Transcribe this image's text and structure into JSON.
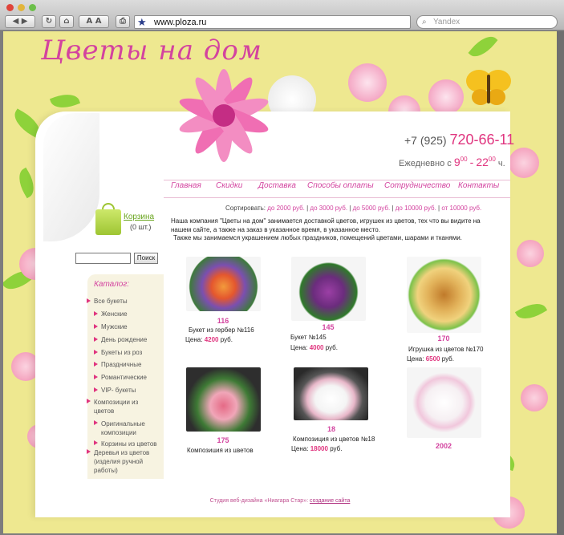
{
  "browser": {
    "url": "www.ploza.ru",
    "search_placeholder": "Yandex",
    "font_button": "A A"
  },
  "site": {
    "logo": "Цветы на дом",
    "phone_prefix": "+7 (925)",
    "phone_main": "720-66-11",
    "hours_prefix": "Ежедневно с",
    "hours_from": "9",
    "hours_from_min": "00",
    "hours_to": "22",
    "hours_to_min": "00",
    "hours_suffix": "ч."
  },
  "nav": [
    "Главная",
    "Скидки",
    "Доставка",
    "Способы оплаты",
    "Сотрудничество",
    "Контакты"
  ],
  "cart": {
    "label": "Корзина",
    "count": "(0 шт.)"
  },
  "search": {
    "button": "Поиск"
  },
  "catalog": {
    "title": "Каталог:",
    "items": [
      {
        "label": "Все букеты"
      },
      {
        "label": "Женские"
      },
      {
        "label": "Мужские"
      },
      {
        "label": "День рождение"
      },
      {
        "label": "Букеты из роз"
      },
      {
        "label": "Праздничные"
      },
      {
        "label": "Романтические"
      },
      {
        "label": "VIP- букеты"
      },
      {
        "label": "Композиции из цветов"
      },
      {
        "label": "Оригинальные композиции"
      },
      {
        "label": "Корзины из цветов"
      },
      {
        "label": "Деревья из цветов (изделия ручной работы)"
      }
    ]
  },
  "sort": {
    "label": "Сортировать:",
    "options": [
      "до 2000 руб.",
      "до 3000 руб.",
      "до 5000 руб.",
      "до 10000 руб.",
      "от 10000 руб."
    ]
  },
  "intro": {
    "line1": "Наша компания \"Цветы на дом\" занимается доставкой цветов, игрушек из цветов, тех что вы видите на нашем сайте, а также на заказ в указанное время, в указанное место.",
    "line2": "Также мы занимаемся украшением любых праздников, помещений цветами, шарами и тканями."
  },
  "products": [
    {
      "num": "116",
      "name": "Букет из гербер №116",
      "price_label": "Цена:",
      "price": "4200",
      "currency": "руб."
    },
    {
      "num": "145",
      "name": "Букет №145",
      "price_label": "Цена:",
      "price": "4000",
      "currency": "руб."
    },
    {
      "num": "170",
      "name": "Игрушка из цветов №170",
      "price_label": "Цена:",
      "price": "6500",
      "currency": "руб."
    },
    {
      "num": "175",
      "name": "Композиция из цветов",
      "price_label": "",
      "price": "",
      "currency": ""
    },
    {
      "num": "18",
      "name": "Композиция из цветов №18",
      "price_label": "Цена:",
      "price": "18000",
      "currency": "руб."
    },
    {
      "num": "2002",
      "name": "",
      "price_label": "",
      "price": "",
      "currency": ""
    }
  ],
  "footer": {
    "text": "Студия веб-дизайна «Ниагара Стар»:",
    "link": "создание сайта"
  },
  "colors": {
    "accent": "#e0357f",
    "link_green": "#6aa51f",
    "background": "#eee890"
  }
}
